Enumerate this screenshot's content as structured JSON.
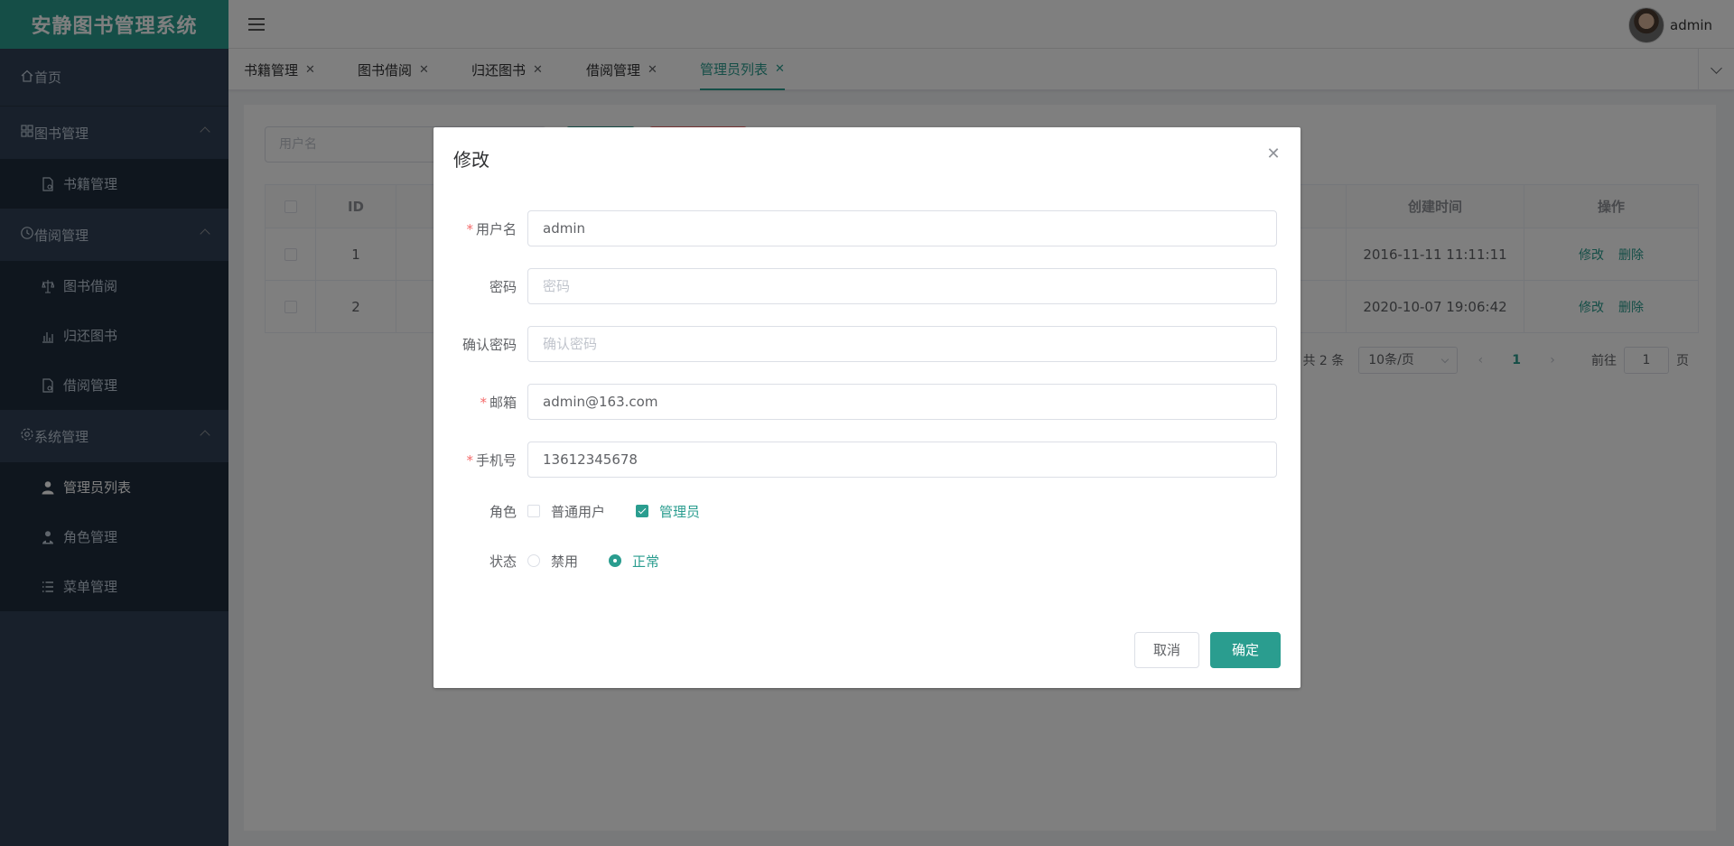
{
  "app": {
    "title": "安静图书管理系统"
  },
  "header": {
    "username": "admin"
  },
  "sidebar": {
    "home": "首页",
    "groups": [
      {
        "label": "图书管理",
        "items": [
          {
            "label": "书籍管理"
          }
        ]
      },
      {
        "label": "借阅管理",
        "items": [
          {
            "label": "图书借阅"
          },
          {
            "label": "归还图书"
          },
          {
            "label": "借阅管理"
          }
        ]
      },
      {
        "label": "系统管理",
        "items": [
          {
            "label": "管理员列表"
          },
          {
            "label": "角色管理"
          },
          {
            "label": "菜单管理"
          }
        ]
      }
    ],
    "active": "管理员列表"
  },
  "tabs": [
    {
      "label": "书籍管理"
    },
    {
      "label": "图书借阅"
    },
    {
      "label": "归还图书"
    },
    {
      "label": "借阅管理"
    },
    {
      "label": "管理员列表"
    }
  ],
  "main": {
    "search_placeholder": "用户名",
    "table": {
      "headers": [
        "ID",
        "创建时间",
        "操作"
      ],
      "rows": [
        {
          "id": "1",
          "created": "2016-11-11 11:11:11",
          "edit": "修改",
          "delete": "删除"
        },
        {
          "id": "2",
          "created": "2020-10-07 19:06:42",
          "edit": "修改",
          "delete": "删除"
        }
      ]
    },
    "pagination": {
      "total": "共 2 条",
      "page_size": "10条/页",
      "current": "1",
      "goto_prefix": "前往",
      "goto_value": "1",
      "goto_suffix": "页"
    }
  },
  "dialog": {
    "title": "修改",
    "fields": {
      "username": {
        "label": "用户名",
        "value": "admin"
      },
      "password": {
        "label": "密码",
        "placeholder": "密码"
      },
      "confirm": {
        "label": "确认密码",
        "placeholder": "确认密码"
      },
      "email": {
        "label": "邮箱",
        "value": "admin@163.com"
      },
      "phone": {
        "label": "手机号",
        "value": "13612345678"
      },
      "role": {
        "label": "角色",
        "options": [
          "普通用户",
          "管理员"
        ]
      },
      "status": {
        "label": "状态",
        "options": [
          "禁用",
          "正常"
        ]
      }
    },
    "cancel": "取消",
    "confirm_btn": "确定"
  },
  "colors": {
    "primary": "#2a9d8f",
    "danger": "#f56c6c",
    "sidebar_bg": "#304156",
    "submenu_bg": "#1f2d3d"
  }
}
